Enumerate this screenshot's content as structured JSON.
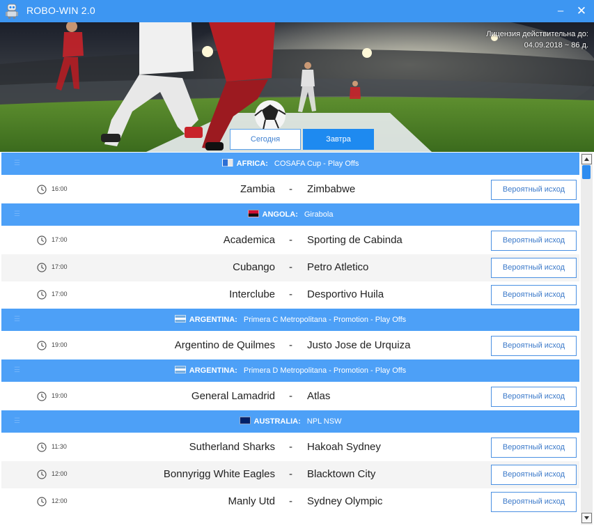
{
  "window": {
    "title": "ROBO-WIN 2.0",
    "minimize_glyph": "–",
    "close_glyph": "✕"
  },
  "banner": {
    "license_line1": "Лицензия действительна до:",
    "license_line2": "04.09.2018 ~ 86 д."
  },
  "tabs": {
    "today": "Сегодня",
    "tomorrow": "Завтра",
    "active": "tomorrow"
  },
  "button_label": "Вероятный исход",
  "groups": [
    {
      "country": "AFRICA:",
      "competition": "COSAFA Cup - Play Offs",
      "flag": "africa",
      "matches": [
        {
          "time": "16:00",
          "home": "Zambia",
          "away": "Zimbabwe"
        }
      ]
    },
    {
      "country": "ANGOLA:",
      "competition": "Girabola",
      "flag": "angola",
      "matches": [
        {
          "time": "17:00",
          "home": "Academica",
          "away": "Sporting de Cabinda"
        },
        {
          "time": "17:00",
          "home": "Cubango",
          "away": "Petro Atletico"
        },
        {
          "time": "17:00",
          "home": "Interclube",
          "away": "Desportivo Huila"
        }
      ]
    },
    {
      "country": "ARGENTINA:",
      "competition": "Primera C Metropolitana - Promotion - Play Offs",
      "flag": "argentina",
      "matches": [
        {
          "time": "19:00",
          "home": "Argentino de Quilmes",
          "away": "Justo Jose de Urquiza"
        }
      ]
    },
    {
      "country": "ARGENTINA:",
      "competition": "Primera D Metropolitana - Promotion - Play Offs",
      "flag": "argentina",
      "matches": [
        {
          "time": "19:00",
          "home": "General Lamadrid",
          "away": "Atlas"
        }
      ]
    },
    {
      "country": "AUSTRALIA:",
      "competition": "NPL NSW",
      "flag": "australia",
      "matches": [
        {
          "time": "11:30",
          "home": "Sutherland Sharks",
          "away": "Hakoah Sydney"
        },
        {
          "time": "12:00",
          "home": "Bonnyrigg White Eagles",
          "away": "Blacktown City"
        },
        {
          "time": "12:00",
          "home": "Manly Utd",
          "away": "Sydney Olympic"
        }
      ]
    }
  ],
  "colors": {
    "titlebar": "#3d96f2",
    "league_bar": "#4da0f7",
    "active_tab": "#1e8af0",
    "button_border": "#4a90e2"
  },
  "icons": {
    "app": "robot-icon",
    "match_time": "clock-icon"
  }
}
